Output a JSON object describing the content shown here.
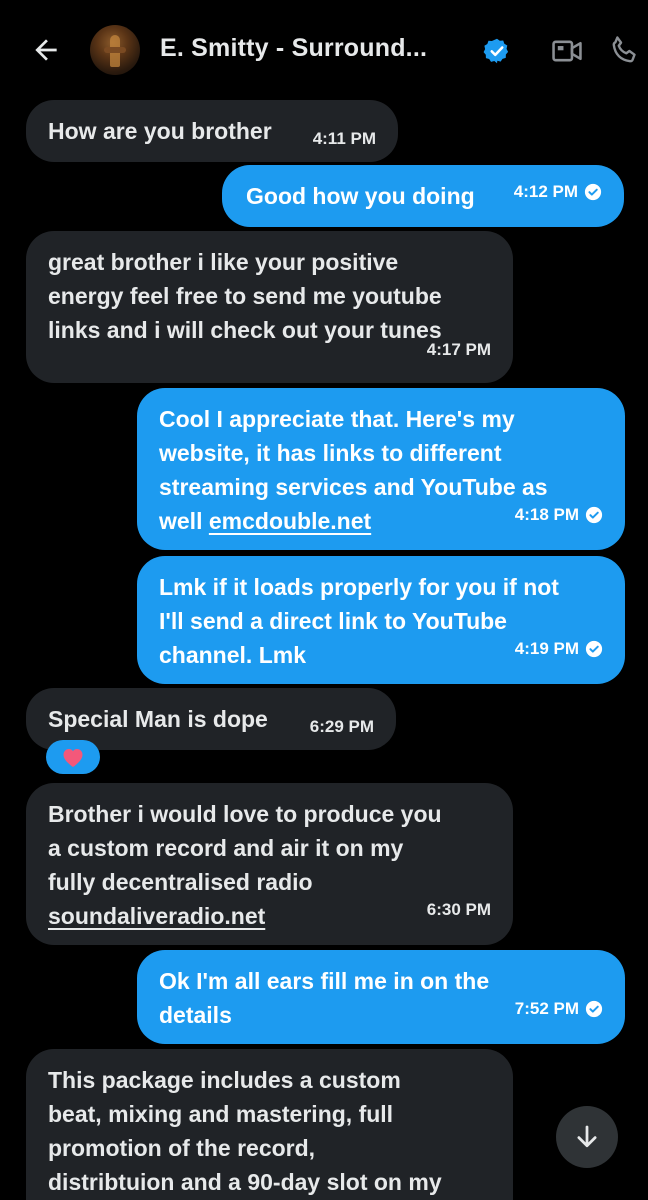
{
  "header": {
    "title": "E. Smitty - Surround..."
  },
  "messages": [
    {
      "text": "How are you brother",
      "time": "4:11 PM"
    },
    {
      "text": "Good how you doing",
      "time": "4:12 PM"
    },
    {
      "lines": [
        "great brother i like your positive",
        "energy feel free to send me youtube",
        "links and i will check out your tunes"
      ],
      "time": "4:17 PM"
    },
    {
      "lines": [
        "Cool I appreciate that. Here's my",
        "website, it has links to different",
        "streaming services and YouTube as"
      ],
      "prefix": "well ",
      "link": "emcdouble.net",
      "time": "4:18 PM"
    },
    {
      "lines": [
        "Lmk if it loads properly for you if not",
        "I'll send a direct link to YouTube",
        "channel. Lmk"
      ],
      "time": "4:19 PM"
    },
    {
      "text": "Special Man is dope",
      "time": "6:29 PM",
      "reaction": "heart"
    },
    {
      "lines": [
        "Brother i would love to produce you",
        "a custom record and air it on my",
        "fully decentralised radio"
      ],
      "link": "soundaliveradio.net",
      "time": "6:30 PM"
    },
    {
      "lines": [
        "Ok I'm all ears fill me in on the",
        "details"
      ],
      "time": "7:52 PM"
    },
    {
      "lines": [
        "This package includes a custom",
        "beat, mixing and mastering, full",
        "promotion of the record,",
        "distribtuion and a 90-day slot on my"
      ]
    }
  ],
  "colors": {
    "background": "#000000",
    "incoming_bubble": "#202327",
    "outgoing_bubble": "#1d9bf0",
    "verified": "#1d9bf0",
    "reaction_heart": "#f4587a"
  },
  "icons": {
    "back": "arrow-left-icon",
    "verified": "verified-badge-icon",
    "video": "video-camera-icon",
    "phone": "phone-icon",
    "read": "check-circle-icon",
    "scroll": "arrow-down-icon"
  }
}
